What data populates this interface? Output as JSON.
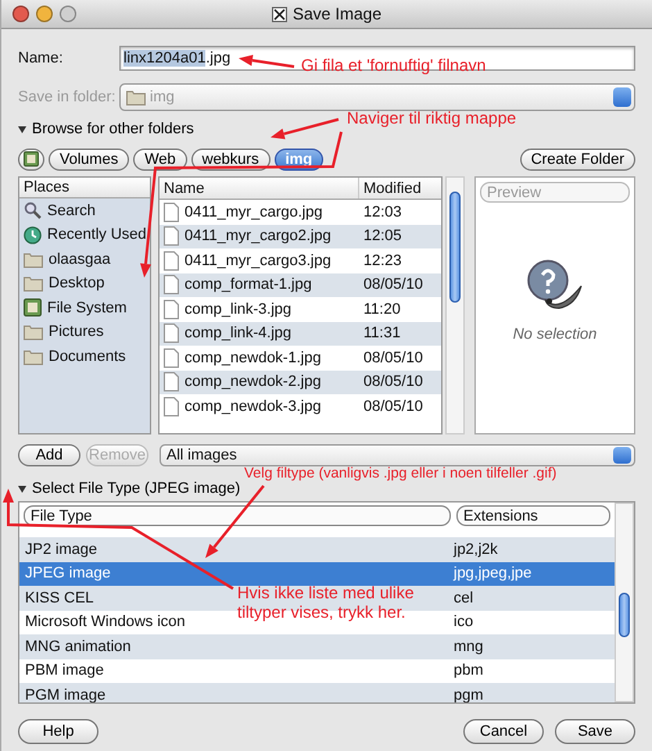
{
  "window": {
    "title": "Save Image"
  },
  "name_field": {
    "label": "Name:",
    "parts": [
      {
        "text": "linx1204a01",
        "selected": true
      },
      {
        "text": ".jpg",
        "selected": false
      }
    ]
  },
  "save_in_folder": {
    "label": "Save in folder:",
    "value": "img",
    "disabled": true
  },
  "browse": {
    "label": "Browse for other folders",
    "expanded": true
  },
  "path_bar": [
    {
      "kind": "icon",
      "selected": false
    },
    {
      "kind": "text",
      "label": "Volumes",
      "selected": false
    },
    {
      "kind": "text",
      "label": "Web",
      "selected": false
    },
    {
      "kind": "text",
      "label": "webkurs",
      "selected": false
    },
    {
      "kind": "text",
      "label": "img",
      "selected": true
    }
  ],
  "create_folder": "Create Folder",
  "places": {
    "header": "Places",
    "items": [
      {
        "label": "Search",
        "kind": "search"
      },
      {
        "label": "Recently Used",
        "kind": "recent"
      },
      {
        "label": "olaasgaa",
        "kind": "folder"
      },
      {
        "label": "Desktop",
        "kind": "folder"
      },
      {
        "label": "File System",
        "kind": "drive"
      },
      {
        "label": "Pictures",
        "kind": "folder"
      },
      {
        "label": "Documents",
        "kind": "folder"
      }
    ]
  },
  "files": {
    "columns": [
      "Name",
      "Modified"
    ],
    "rows": [
      {
        "name": "0411_myr_cargo.jpg",
        "modified": "12:03"
      },
      {
        "name": "0411_myr_cargo2.jpg",
        "modified": "12:05"
      },
      {
        "name": "0411_myr_cargo3.jpg",
        "modified": "12:23"
      },
      {
        "name": "comp_format-1.jpg",
        "modified": "08/05/10"
      },
      {
        "name": "comp_link-3.jpg",
        "modified": "11:20"
      },
      {
        "name": "comp_link-4.jpg",
        "modified": "11:31"
      },
      {
        "name": "comp_newdok-1.jpg",
        "modified": "08/05/10"
      },
      {
        "name": "comp_newdok-2.jpg",
        "modified": "08/05/10"
      },
      {
        "name": "comp_newdok-3.jpg",
        "modified": "08/05/10"
      }
    ]
  },
  "preview": {
    "label": "Preview",
    "message": "No selection"
  },
  "place_buttons": [
    {
      "label": "Add",
      "disabled": false
    },
    {
      "label": "Remove",
      "disabled": true
    }
  ],
  "filter": "All images",
  "file_type": {
    "label": "Select File Type (JPEG image)",
    "expanded": true,
    "columns": [
      "File Type",
      "Extensions"
    ],
    "rows": [
      {
        "type": "JP2 image",
        "extensions": "jp2,j2k",
        "selected": false
      },
      {
        "type": "JPEG image",
        "extensions": "jpg,jpeg,jpe",
        "selected": true
      },
      {
        "type": "KISS CEL",
        "extensions": "cel",
        "selected": false
      },
      {
        "type": "Microsoft Windows icon",
        "extensions": "ico",
        "selected": false
      },
      {
        "type": "MNG animation",
        "extensions": "mng",
        "selected": false
      },
      {
        "type": "PBM image",
        "extensions": "pbm",
        "selected": false
      },
      {
        "type": "PGM image",
        "extensions": "pgm",
        "selected": false
      }
    ]
  },
  "buttons": [
    {
      "label": "Help",
      "kind": "left"
    },
    {
      "label": "Cancel",
      "kind": "right"
    },
    {
      "label": "Save",
      "kind": "right"
    }
  ],
  "annotations": [
    {
      "text": "Gi fila et 'fornuftig' filnavn"
    },
    {
      "text": "Naviger til riktig mappe"
    },
    {
      "text": "Velg filtype (vanligvis .jpg eller i noen tilfeller .gif)"
    },
    {
      "text": "Hvis ikke liste med ulike tiltyper vises, trykk her."
    }
  ]
}
